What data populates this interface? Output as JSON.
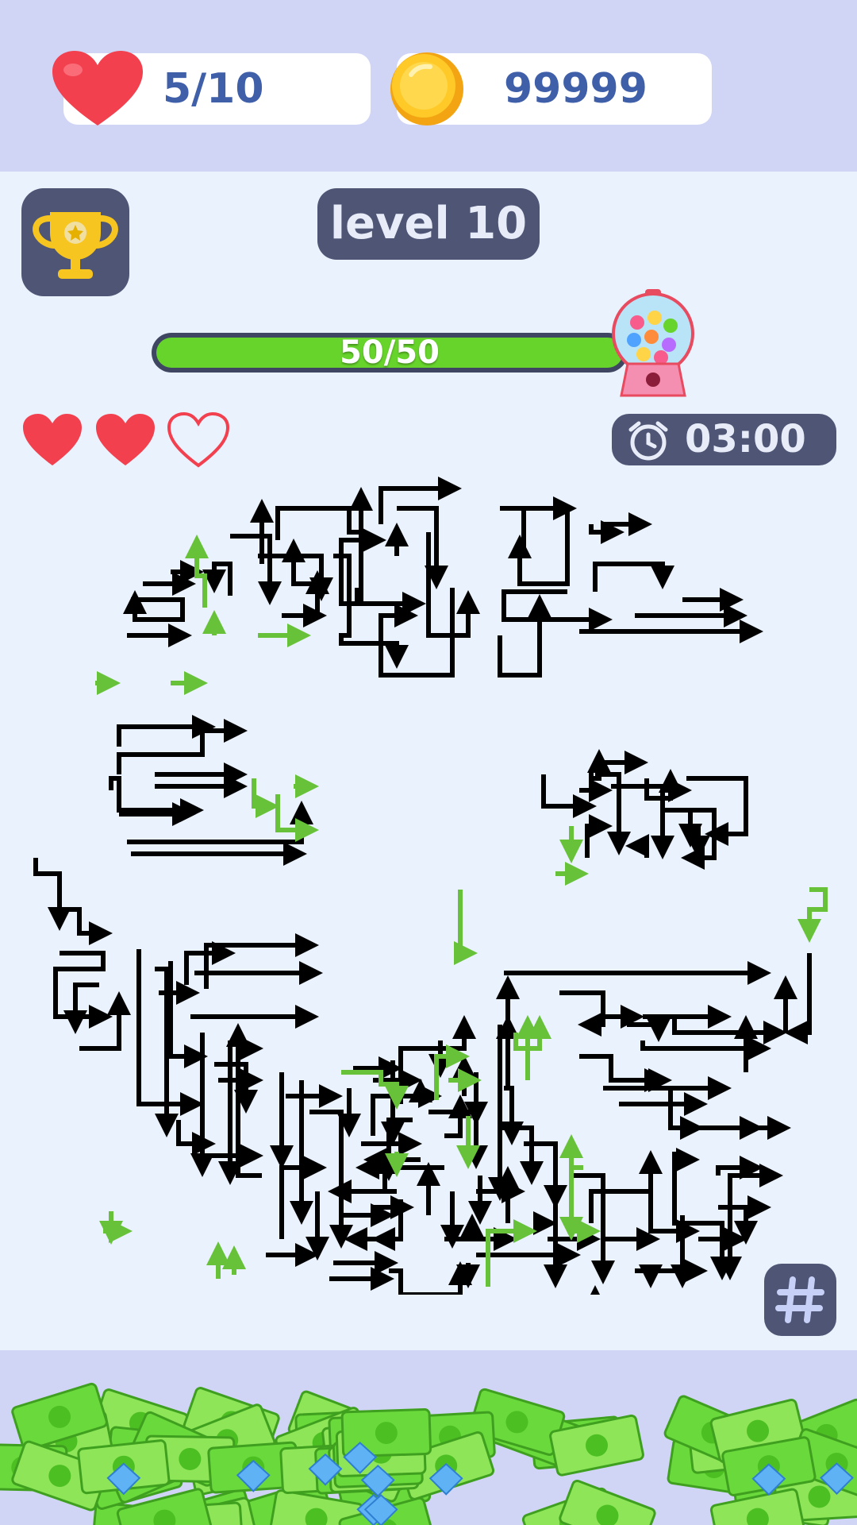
{
  "header": {
    "lives_label": "5/10",
    "coins_label": "99999",
    "icons": {
      "lives": "heart-icon",
      "coins": "coin-icon"
    }
  },
  "level": {
    "label": "level 10"
  },
  "progress": {
    "label": "50/50",
    "value": 50,
    "max": 50,
    "reward_icon": "gumball-machine-icon"
  },
  "attempts": {
    "filled": 2,
    "total": 3
  },
  "timer": {
    "label": "03:00",
    "icon": "alarm-clock-icon"
  },
  "buttons": {
    "trophy": "trophy-icon",
    "grid": "grid-icon"
  },
  "maze": {
    "description_icon": "arrow-maze",
    "colors": {
      "arrow": "#000000",
      "escaped_arrow": "#67c23a"
    }
  },
  "colors": {
    "bar_bg": "#d0d5f6",
    "game_bg": "#eaf2fd",
    "panel": "#4e5575",
    "accent_green": "#67d42c",
    "text_blue": "#3f5fa9",
    "heart_red": "#f2404f"
  }
}
